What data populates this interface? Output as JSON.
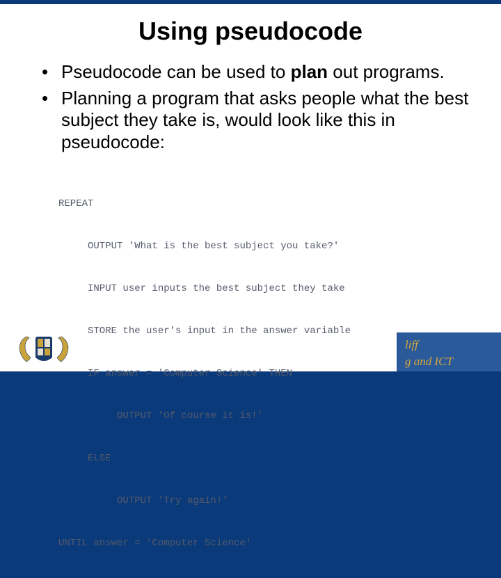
{
  "title": "Using pseudocode",
  "bullets": [
    {
      "pre": "Pseudocode can be used to ",
      "bold": "plan",
      "post": " out programs."
    },
    {
      "pre": "Planning a program that asks people what the best subject they take is, would look like this in pseudocode:",
      "bold": "",
      "post": ""
    }
  ],
  "code": [
    "REPEAT",
    "     OUTPUT 'What is the best subject you take?'",
    "     INPUT user inputs the best subject they take",
    "     STORE the user's input in the answer variable",
    "     IF answer = 'Computer Science' THEN",
    "          OUTPUT 'Of course it is!'",
    "     ELSE",
    "          OUTPUT 'Try again!'",
    "UNTIL answer = 'Computer Science'"
  ],
  "footer": {
    "line1": "liff",
    "line2": "g and ICT"
  }
}
